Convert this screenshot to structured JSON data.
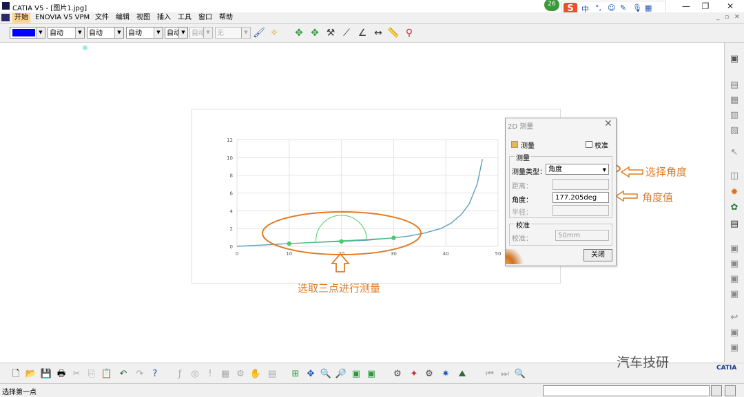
{
  "window": {
    "title": "CATIA V5 - [图片1.jpg]",
    "notification_count": "26",
    "ime": {
      "logo": "S",
      "mode": "中"
    }
  },
  "menu": [
    "开始",
    "ENOVIA V5 VPM",
    "文件",
    "编辑",
    "视图",
    "插入",
    "工具",
    "窗口",
    "帮助"
  ],
  "toolbar": {
    "color_combo": "",
    "line_combo1": "自动",
    "line_combo2": "自动",
    "line_combo3": "自动",
    "line_combo4": "自动",
    "layer_combo": "自动",
    "combo6": "自动",
    "combo7": "无",
    "accent_color": "#0000ff"
  },
  "chart_data": {
    "type": "line",
    "x_ticks": [
      "0",
      "10",
      "20",
      "30",
      "40",
      "50"
    ],
    "y_ticks": [
      "0",
      "2",
      "4",
      "6",
      "8",
      "10",
      "12"
    ],
    "xlim": [
      0,
      50
    ],
    "ylim": [
      0,
      12
    ],
    "grid": true,
    "series": [
      {
        "x": [
          0,
          5,
          10,
          15,
          20,
          25,
          30,
          33,
          36,
          39,
          41,
          43,
          44.5,
          46,
          47
        ],
        "y": [
          0,
          0.15,
          0.3,
          0.45,
          0.55,
          0.7,
          0.95,
          1.15,
          1.5,
          2.0,
          2.6,
          3.6,
          4.8,
          7.0,
          9.8
        ],
        "color": "#5aa0b8"
      }
    ],
    "selected_points": [
      {
        "x": 10,
        "y": 0.3
      },
      {
        "x": 20,
        "y": 0.55
      },
      {
        "x": 30,
        "y": 0.95
      }
    ],
    "point_color": "#44cc66"
  },
  "dialog": {
    "title": "2D 测量",
    "measure_check": "测量",
    "calibrate_check": "校准",
    "group_measure": "测量",
    "type_label": "测量类型：",
    "type_value": "角度",
    "distance_label": "距离：",
    "angle_label": "角度：",
    "angle_value": "177.205deg",
    "radius_label": "半径：",
    "group_calibrate": "校准",
    "calibrate_label": "校准：",
    "calibrate_value": "50mm",
    "close_button": "关闭"
  },
  "annotations": {
    "select_angle": "选择角度",
    "angle_value": "角度值",
    "three_points": "选取三点进行测量",
    "color": "#e07b22"
  },
  "status": {
    "prompt": "选择第一点"
  },
  "watermark": "汽车技研",
  "logo": "CATIA"
}
